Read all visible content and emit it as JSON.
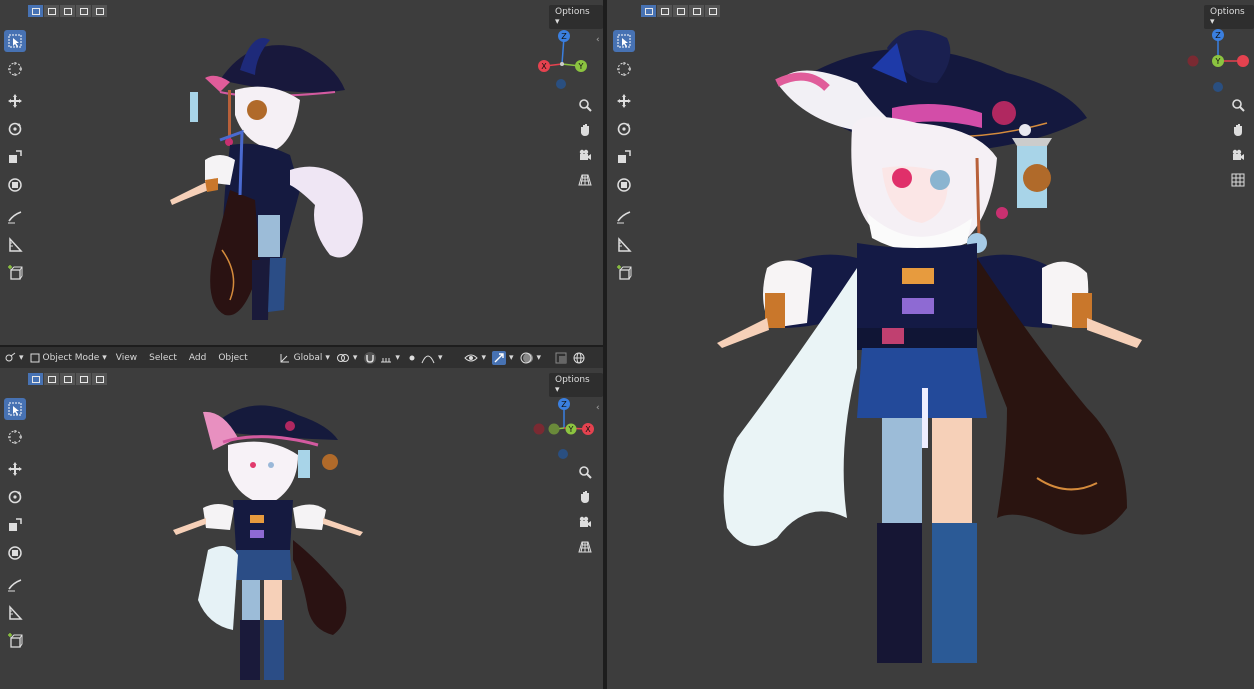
{
  "header": {
    "mode": "Object Mode",
    "menus": [
      "View",
      "Select",
      "Add",
      "Object"
    ],
    "transform": "Global"
  },
  "viewports": {
    "top_left": {
      "options_label": "Options"
    },
    "bottom_left": {
      "options_label": "Options"
    },
    "right": {
      "options_label": "Options"
    }
  },
  "toolbar_tools": [
    "select-box",
    "cursor",
    "move",
    "rotate",
    "scale",
    "transform",
    "annotate",
    "measure",
    "add-cube"
  ],
  "nav_tools": [
    "zoom-icon",
    "hand-pan-icon",
    "camera-icon",
    "grid-icon"
  ],
  "gizmo_axes": {
    "z": "Z",
    "y": "Y",
    "x": "X"
  },
  "colors": {
    "accent": "#4772b3",
    "x_axis": "#e5424f",
    "y_axis": "#8cc440",
    "z_axis": "#3a7fe0"
  }
}
